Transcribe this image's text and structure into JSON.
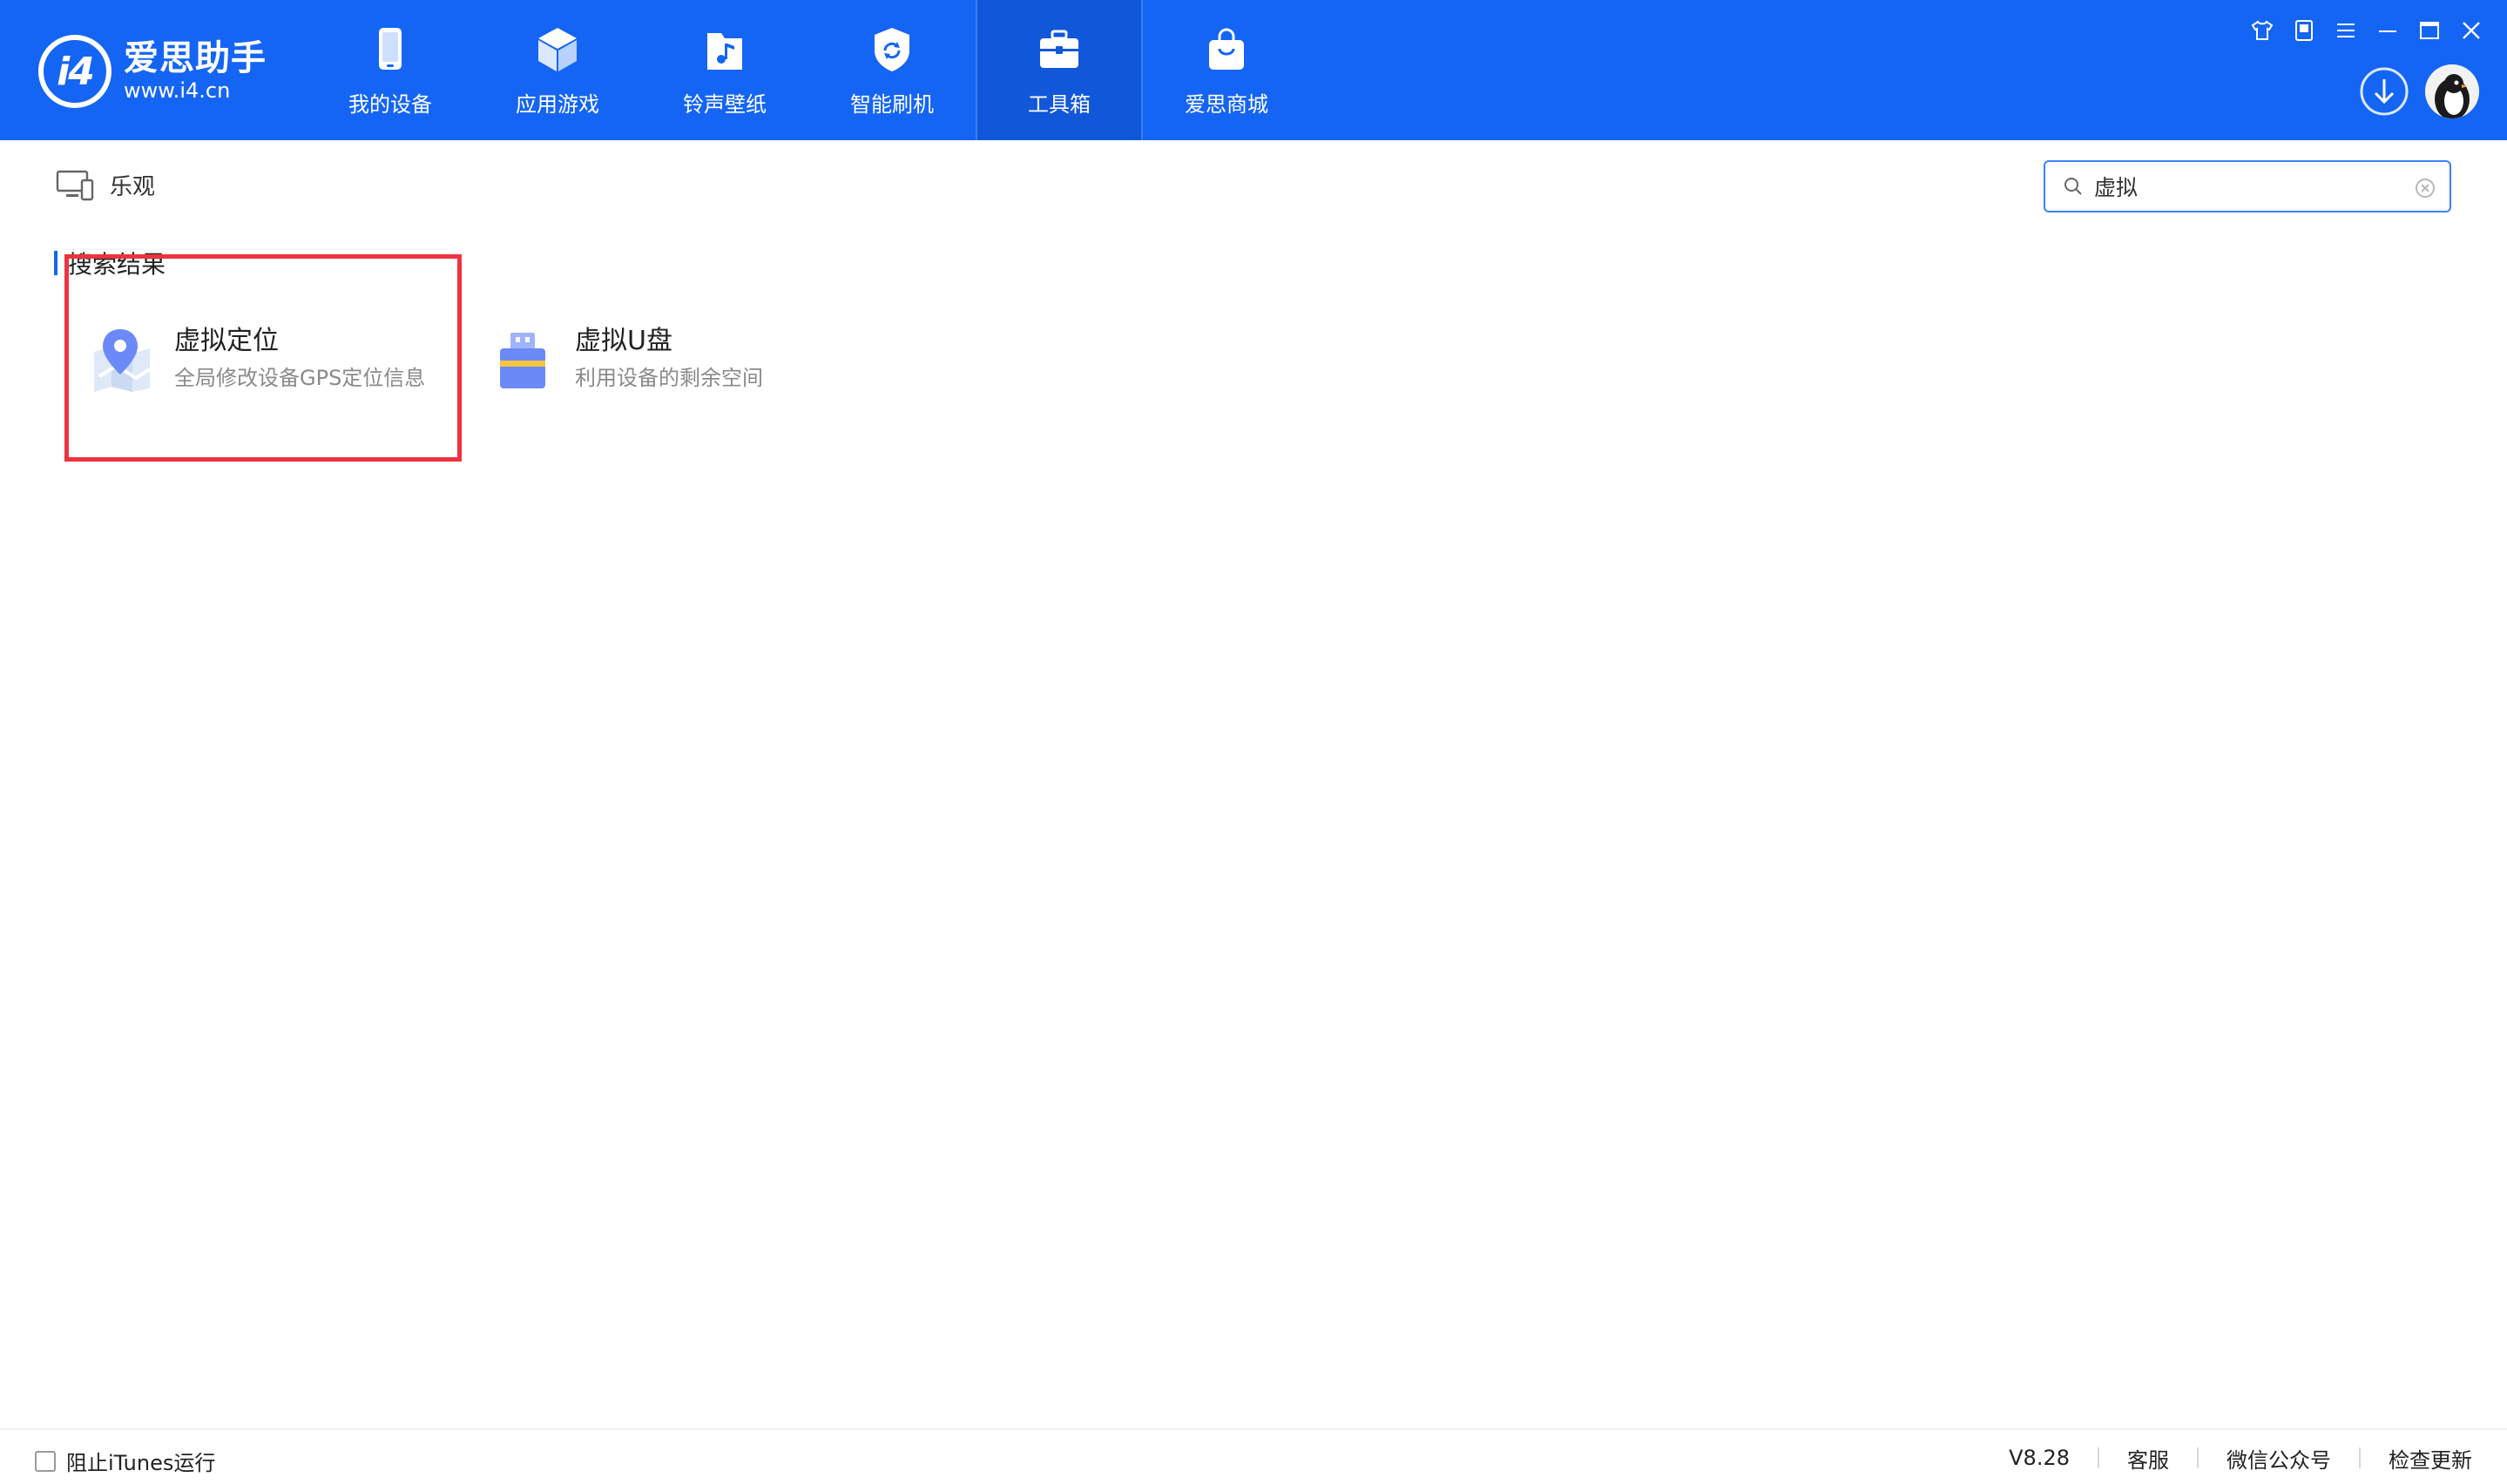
{
  "app": {
    "logo_mark": "i4",
    "logo_title": "爱思助手",
    "logo_url": "www.i4.cn"
  },
  "nav": {
    "items": [
      {
        "label": "我的设备",
        "icon": "phone-icon"
      },
      {
        "label": "应用游戏",
        "icon": "cube-icon"
      },
      {
        "label": "铃声壁纸",
        "icon": "music-folder-icon"
      },
      {
        "label": "智能刷机",
        "icon": "shield-refresh-icon"
      },
      {
        "label": "工具箱",
        "icon": "toolbox-icon",
        "active": true
      },
      {
        "label": "爱思商城",
        "icon": "shopping-bag-icon"
      }
    ]
  },
  "device": {
    "name": "乐观",
    "icon": "computer-icon"
  },
  "search": {
    "value": "虚拟",
    "icon": "search-icon"
  },
  "section": {
    "title": "搜索结果"
  },
  "results": [
    {
      "title": "虚拟定位",
      "desc": "全局修改设备GPS定位信息",
      "icon": "map-pin-icon",
      "highlighted": true
    },
    {
      "title": "虚拟U盘",
      "desc": "利用设备的剩余空间",
      "icon": "usb-drive-icon"
    }
  ],
  "footer": {
    "itunes_label": "阻止iTunes运行",
    "version": "V8.28",
    "service": "客服",
    "wechat": "微信公众号",
    "update": "检查更新"
  },
  "colors": {
    "header_bg": "#1565f5",
    "header_active": "#1157d9",
    "accent": "#3b82f6",
    "highlight_border": "#ee3340"
  }
}
